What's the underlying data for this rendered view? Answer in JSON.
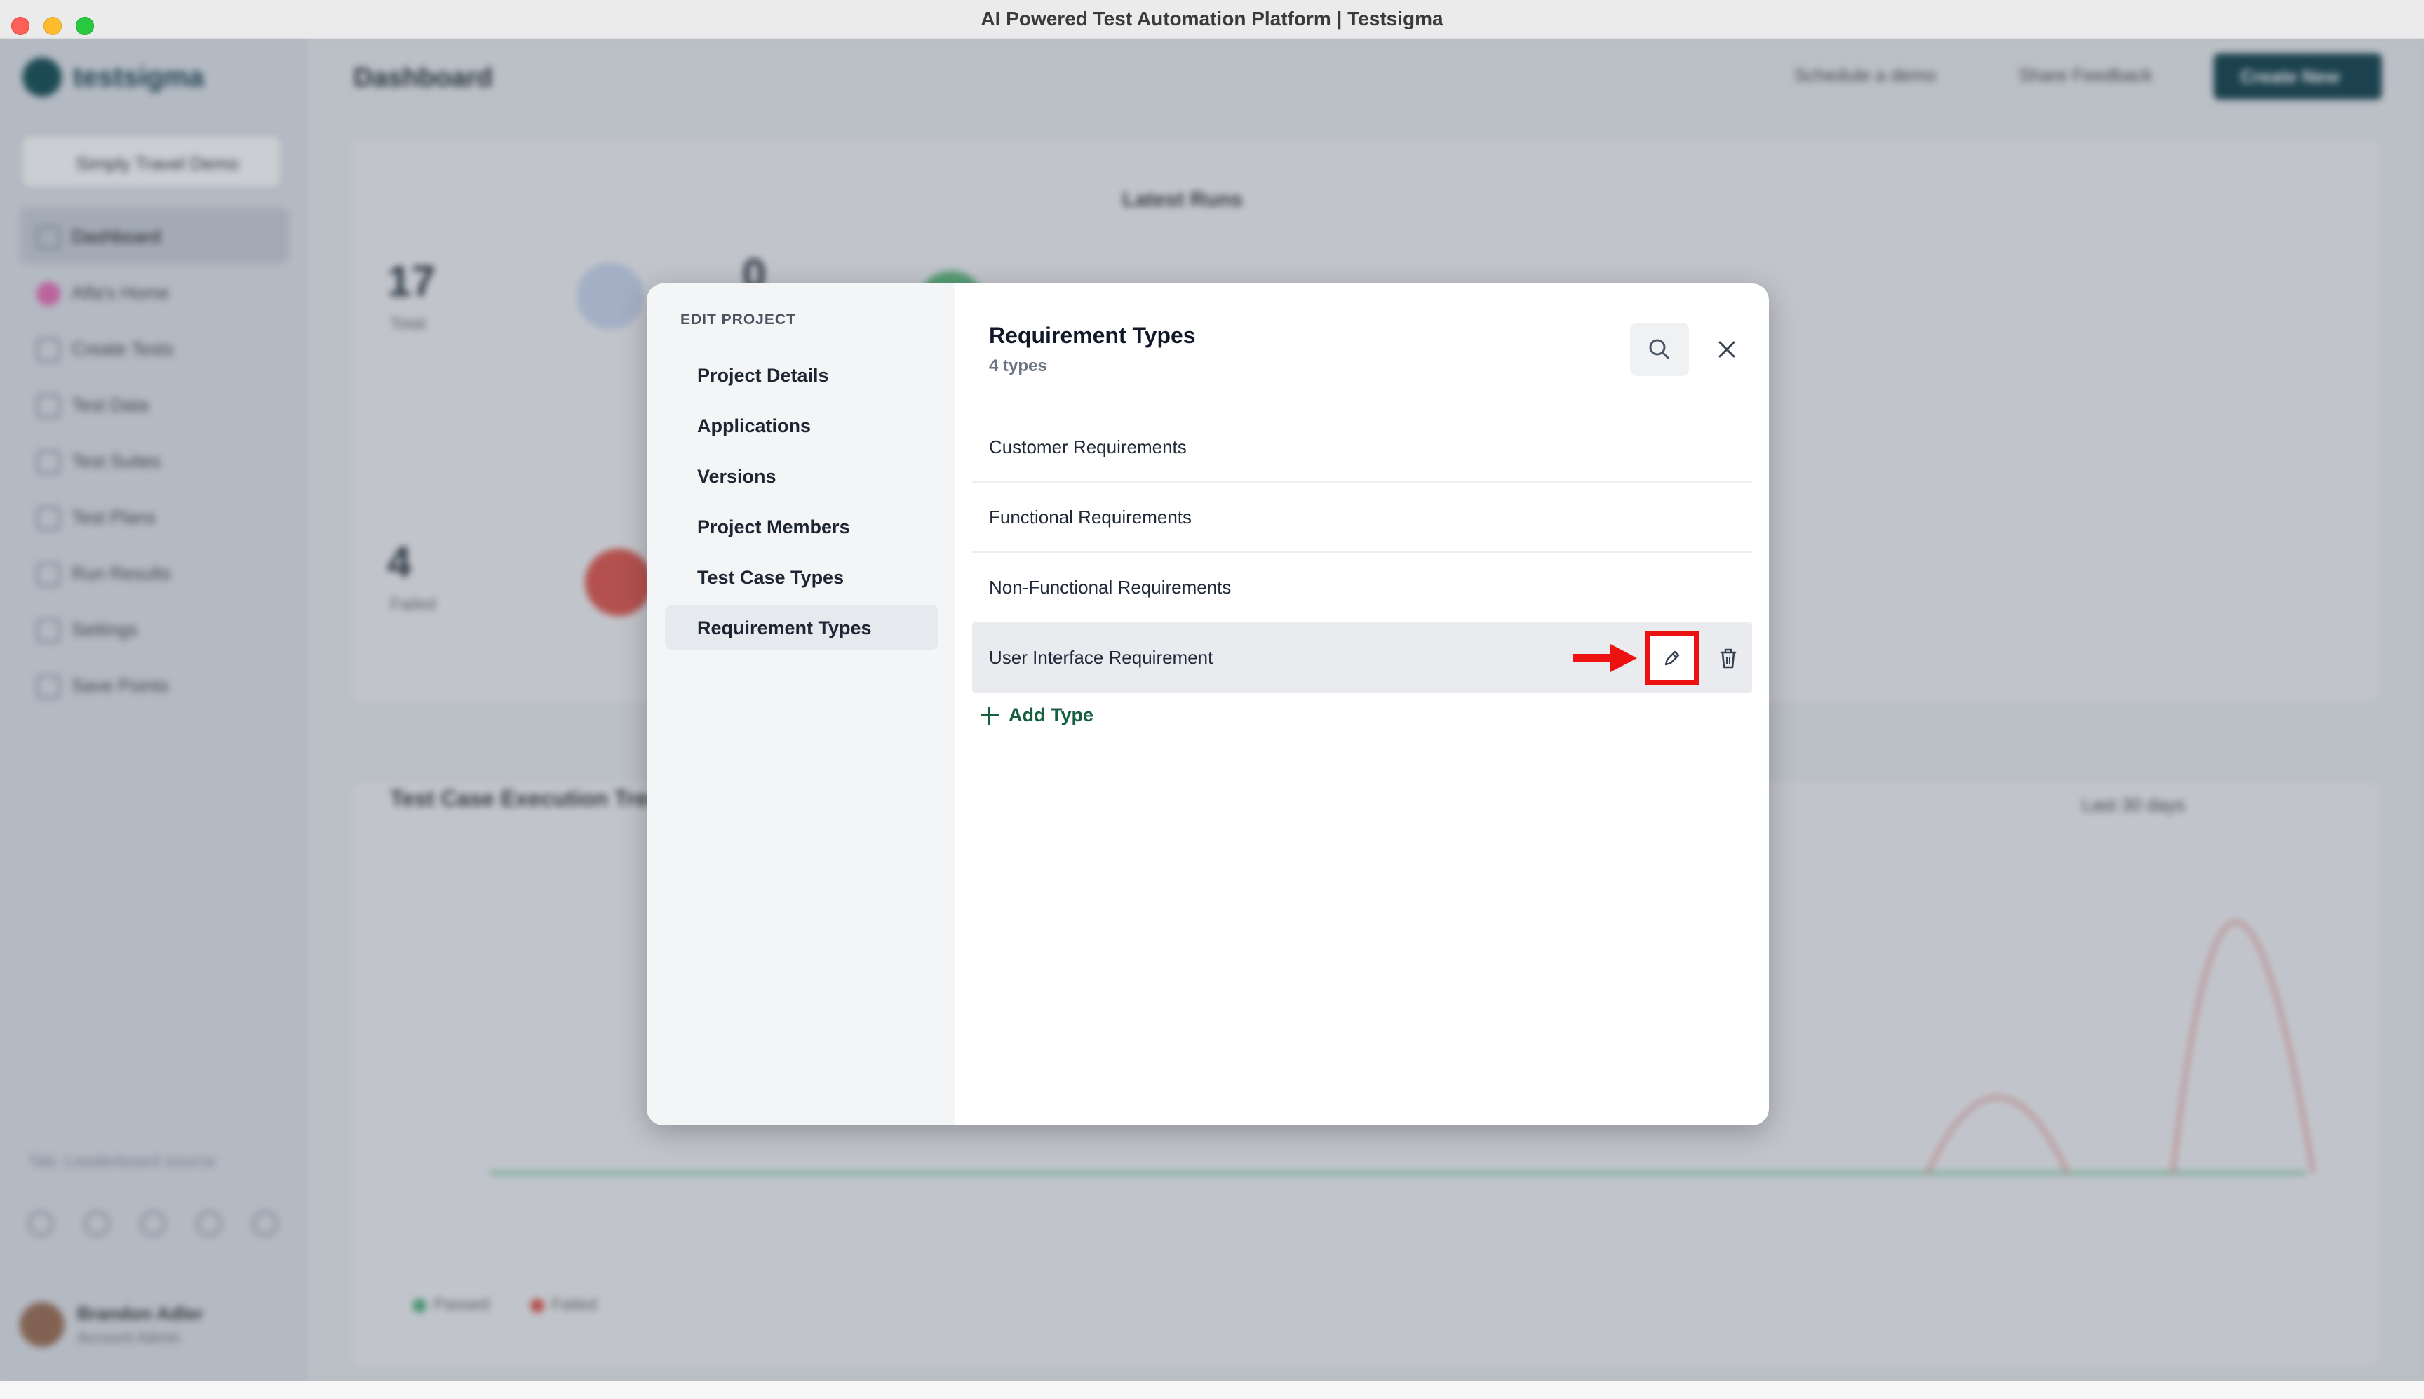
{
  "window": {
    "title": "AI Powered Test Automation Platform | Testsigma"
  },
  "background": {
    "logo_text": "testsigma",
    "project_selector": "Simply Travel Demo",
    "nav": [
      "Dashboard",
      "Alfa's Home",
      "Create Tests",
      "Test Data",
      "Test Suites",
      "Test Plans",
      "Run Results",
      "Settings",
      "Save Points"
    ],
    "search_hint": "Tab: Leaderboard source",
    "user": {
      "name": "Brandon Adler",
      "role": "Account Admin"
    },
    "page_title": "Dashboard",
    "schedule_demo": "Schedule a demo",
    "share_feedback": "Share Feedback",
    "create_new": "Create New",
    "stats": {
      "total_value": "17",
      "total_label": "Total",
      "zero_value": "0",
      "failed_value": "4",
      "failed_label": "Failed"
    },
    "latest_runs": "Latest Runs",
    "chart_title": "Test Case Execution Trend",
    "range": "Last 30 days",
    "legend": [
      "Passed",
      "Failed"
    ],
    "colors": {
      "passed": "#4caf7d",
      "failed": "#e0534a",
      "accent": "#0d3e4a"
    }
  },
  "modal": {
    "nav_heading": "EDIT PROJECT",
    "nav_items": [
      "Project Details",
      "Applications",
      "Versions",
      "Project Members",
      "Test Case Types",
      "Requirement Types"
    ],
    "active_nav": "Requirement Types",
    "title": "Requirement Types",
    "count": "4 types",
    "types": [
      "Customer Requirements",
      "Functional Requirements",
      "Non-Functional Requirements",
      "User Interface Requirement"
    ],
    "add_label": "Add Type",
    "icons": {
      "search": "search-icon",
      "close": "close-icon",
      "edit": "pencil-icon",
      "delete": "trash-icon",
      "add": "plus-icon",
      "annotation": "red-arrow"
    },
    "colors": {
      "accent_green": "#16603f",
      "annotation_red": "#ee1111"
    }
  }
}
